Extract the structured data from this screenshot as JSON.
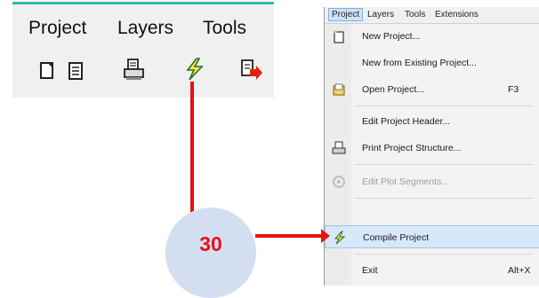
{
  "left_toolbar": {
    "menu": [
      "Project",
      "Layers",
      "Tools"
    ],
    "icons": [
      "new-project-icon",
      "new-from-existing-icon",
      "print-icon",
      "compile-lightning-icon",
      "export-arrow-icon"
    ]
  },
  "callout": {
    "number": "30"
  },
  "menu_window": {
    "menubar": [
      "Project",
      "Layers",
      "Tools",
      "Extensions"
    ],
    "items": [
      {
        "label": "New Project...",
        "shortcut": "",
        "icon": "new-project-icon"
      },
      {
        "label": "New from Existing Project...",
        "shortcut": "",
        "icon": ""
      },
      {
        "label": "Open Project...",
        "shortcut": "F3",
        "icon": "open-project-icon"
      },
      {
        "label": "Edit Project Header...",
        "shortcut": "",
        "icon": ""
      },
      {
        "label": "Print Project Structure...",
        "shortcut": "",
        "icon": "print-icon"
      },
      {
        "label": "Edit Plot Segments...",
        "shortcut": "",
        "icon": "plot-segments-icon"
      },
      {
        "label": "Compile Project",
        "shortcut": "",
        "icon": "compile-lightning-icon"
      },
      {
        "label": "Exit",
        "shortcut": "Alt+X",
        "icon": ""
      }
    ]
  },
  "colors": {
    "accent_red": "#e81010",
    "callout_fill": "#d3def0",
    "highlight": "#d7e8f8"
  }
}
